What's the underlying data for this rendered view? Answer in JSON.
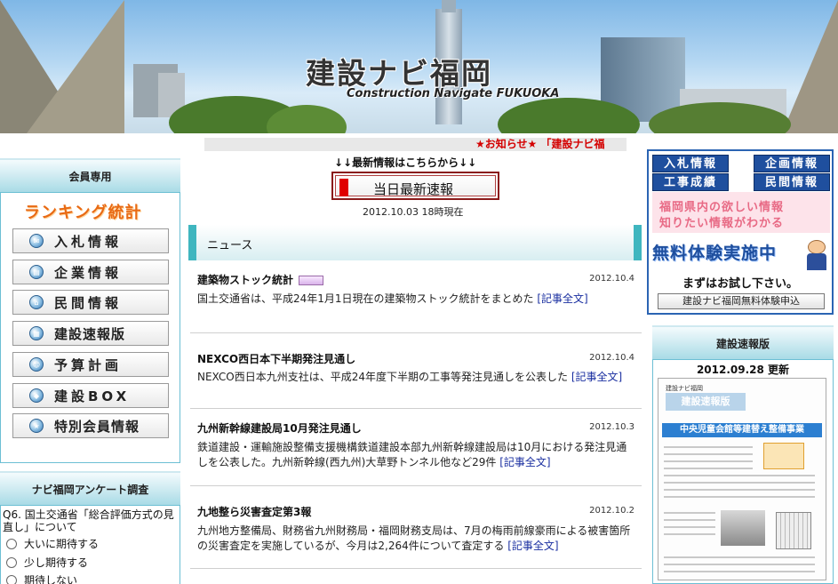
{
  "header": {
    "title": "建設ナビ福岡",
    "subtitle": "Construction Navigate FUKUOKA"
  },
  "ticker": {
    "text": "★お知らせ★ 「建設ナビ福"
  },
  "sidebar": {
    "member_heading": "会員専用",
    "ranking_label": "ランキング統計",
    "menu": [
      {
        "label": "入札情報",
        "icon": "bid-icon"
      },
      {
        "label": "企業情報",
        "icon": "company-icon"
      },
      {
        "label": "民間情報",
        "icon": "private-icon"
      },
      {
        "label": "建設速報版",
        "icon": "bulletin-icon"
      },
      {
        "label": "予算計画",
        "icon": "budget-icon"
      },
      {
        "label": "建設BOX",
        "icon": "box-icon"
      },
      {
        "label": "特別会員情報",
        "icon": "special-member-icon"
      }
    ],
    "survey": {
      "heading": "ナビ福岡アンケート調査",
      "question": "Q6. 国土交通省「総合評価方式の見直し」について",
      "options": [
        "大いに期待する",
        "少し期待する",
        "期待しない"
      ]
    }
  },
  "center": {
    "latest_label": "↓↓最新情報はこちらから↓↓",
    "latest_button": "当日最新速報",
    "latest_time": "2012.10.03 18時現在",
    "news_heading": "ニュース",
    "news": [
      {
        "title": "建築物ストック統計",
        "date": "2012.10.4",
        "body": "国土交通省は、平成24年1月1日現在の建築物ストック統計をまとめた",
        "link": "[記事全文]"
      },
      {
        "title": "NEXCO西日本下半期発注見通し",
        "date": "2012.10.4",
        "body": "NEXCO西日本九州支社は、平成24年度下半期の工事等発注見通しを公表した",
        "link": "[記事全文]"
      },
      {
        "title": "九州新幹線建設局10月発注見通し",
        "date": "2012.10.3",
        "body": "鉄道建設・運輸施設整備支援機構鉄道建設本部九州新幹線建設局は10月における発注見通しを公表した。九州新幹線(西九州)大草野トンネル他など29件",
        "link": "[記事全文]"
      },
      {
        "title": "九地整ら災害査定第3報",
        "date": "2012.10.2",
        "body": "九州地方整備局、財務省九州財務局・福岡財務支局は、7月の梅雨前線豪雨による被害箇所の災害査定を実施しているが、今月は2,264件について査定する",
        "link": "[記事全文]"
      }
    ]
  },
  "right": {
    "ad": {
      "tabs": [
        "入札情報",
        "企画情報",
        "工事成績",
        "民間情報"
      ],
      "line1": "福岡県内の欲しい情報",
      "line2": "知りたい情報がわかる",
      "free": "無料体験実施中",
      "try": "まずはお試し下さい。",
      "signup": "建設ナビ福岡無料体験申込"
    },
    "bulletin": {
      "heading": "建設速報版",
      "date": "2012.09.28 更新",
      "paper_top": "建設ナビ福岡",
      "paper_banner": "建設速報版",
      "paper_headline": "中央児童会館等建替え整備事業"
    }
  }
}
